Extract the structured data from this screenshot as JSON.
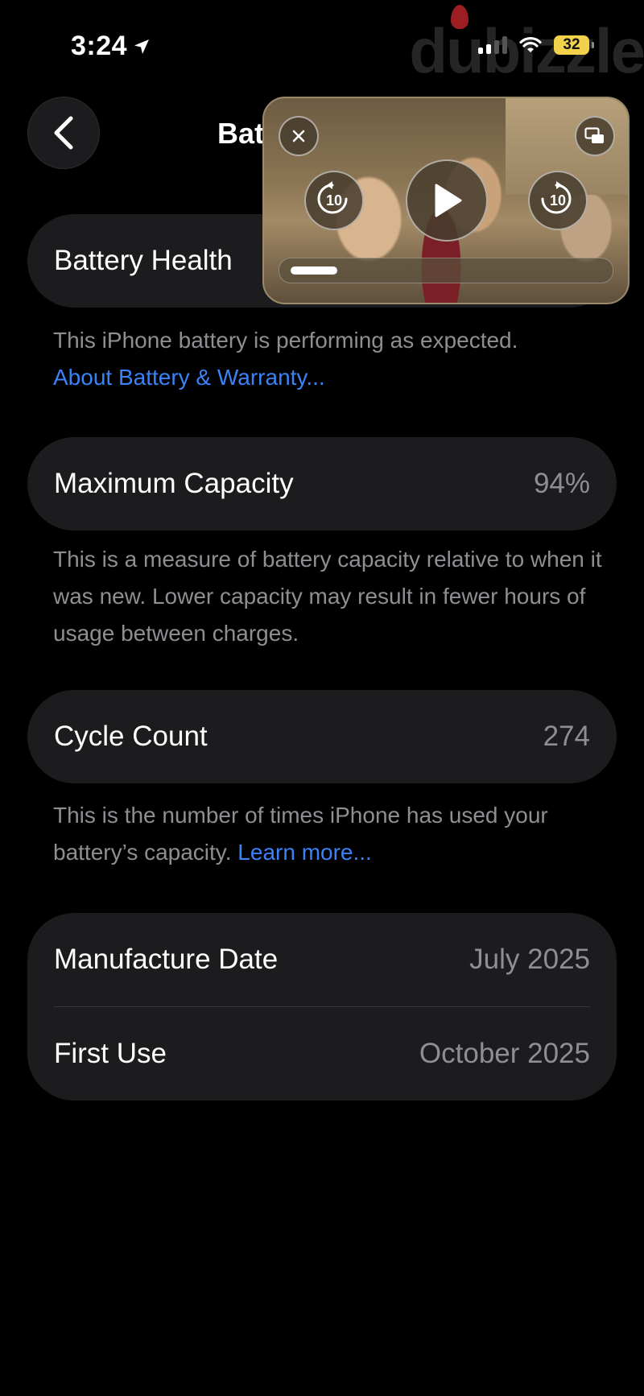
{
  "status_bar": {
    "time": "3:24",
    "battery_level": "32",
    "watermark": "dubizzle"
  },
  "nav": {
    "title": "Bat"
  },
  "battery_health": {
    "label": "Battery Health",
    "note": "This iPhone battery is performing as expected.",
    "link": "About Battery & Warranty..."
  },
  "maximum_capacity": {
    "label": "Maximum Capacity",
    "value": "94%",
    "note": "This is a measure of battery capacity relative to when it was new. Lower capacity may result in fewer hours of usage between charges."
  },
  "cycle_count": {
    "label": "Cycle Count",
    "value": "274",
    "note": "This is the number of times iPhone has used your battery’s capacity.",
    "link": "Learn more..."
  },
  "dates": [
    {
      "label": "Manufacture Date",
      "value": "July 2025"
    },
    {
      "label": "First Use",
      "value": "October 2025"
    }
  ],
  "pip_player": {
    "skip_back_label": "10",
    "skip_forward_label": "10",
    "progress": 0.15
  },
  "colors": {
    "accent_link": "#3b82f6",
    "card_bg": "#1c1c1e",
    "battery_fill": "#f2d24a"
  }
}
